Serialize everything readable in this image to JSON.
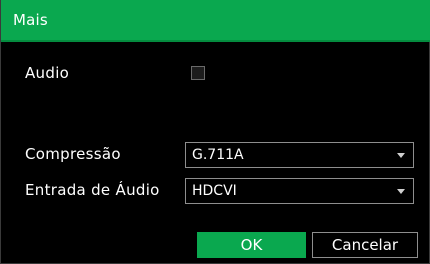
{
  "dialog": {
    "title": "Mais"
  },
  "audio": {
    "label": "Audio",
    "checked": false
  },
  "compression": {
    "label": "Compressão",
    "value": "G.711A"
  },
  "audio_input": {
    "label": "Entrada de Áudio",
    "value": "HDCVI"
  },
  "buttons": {
    "ok_label": "OK",
    "cancel_label": "Cancelar"
  },
  "colors": {
    "accent": "#0aa84f",
    "background": "#000000",
    "border": "#8e8e8e",
    "text": "#ffffff"
  }
}
